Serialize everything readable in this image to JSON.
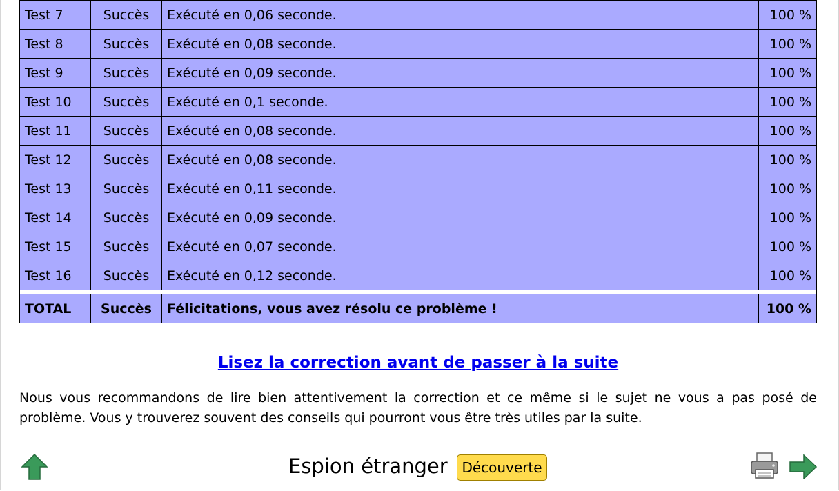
{
  "results": {
    "rows": [
      {
        "test": "Test 7",
        "status": "Succès",
        "message": "Exécuté en 0,06 seconde.",
        "score": "100 %"
      },
      {
        "test": "Test 8",
        "status": "Succès",
        "message": "Exécuté en 0,08 seconde.",
        "score": "100 %"
      },
      {
        "test": "Test 9",
        "status": "Succès",
        "message": "Exécuté en 0,09 seconde.",
        "score": "100 %"
      },
      {
        "test": "Test 10",
        "status": "Succès",
        "message": "Exécuté en 0,1 seconde.",
        "score": "100 %"
      },
      {
        "test": "Test 11",
        "status": "Succès",
        "message": "Exécuté en 0,08 seconde.",
        "score": "100 %"
      },
      {
        "test": "Test 12",
        "status": "Succès",
        "message": "Exécuté en 0,08 seconde.",
        "score": "100 %"
      },
      {
        "test": "Test 13",
        "status": "Succès",
        "message": "Exécuté en 0,11 seconde.",
        "score": "100 %"
      },
      {
        "test": "Test 14",
        "status": "Succès",
        "message": "Exécuté en 0,09 seconde.",
        "score": "100 %"
      },
      {
        "test": "Test 15",
        "status": "Succès",
        "message": "Exécuté en 0,07 seconde.",
        "score": "100 %"
      },
      {
        "test": "Test 16",
        "status": "Succès",
        "message": "Exécuté en 0,12 seconde.",
        "score": "100 %"
      }
    ],
    "total": {
      "test": "TOTAL",
      "status": "Succès",
      "message": "Félicitations, vous avez résolu ce problème !",
      "score": "100 %"
    }
  },
  "correction_link": "Lisez la correction avant de passer à la suite",
  "advice": "Nous vous recommandons de lire bien attentivement la correction et ce même si le sujet ne vous a pas posé de problème. Vous y trouverez souvent des conseils qui pourront vous être très utiles par la suite.",
  "footer": {
    "title": "Espion étranger",
    "level_badge": "Découverte",
    "icons": [
      "up-arrow-icon",
      "printer-icon",
      "next-arrow-icon"
    ]
  },
  "colors": {
    "table_bg": "#aaaaff",
    "link": "#0000ee",
    "badge_bg": "#ffdb4d",
    "arrow": "#3a9a5a"
  }
}
